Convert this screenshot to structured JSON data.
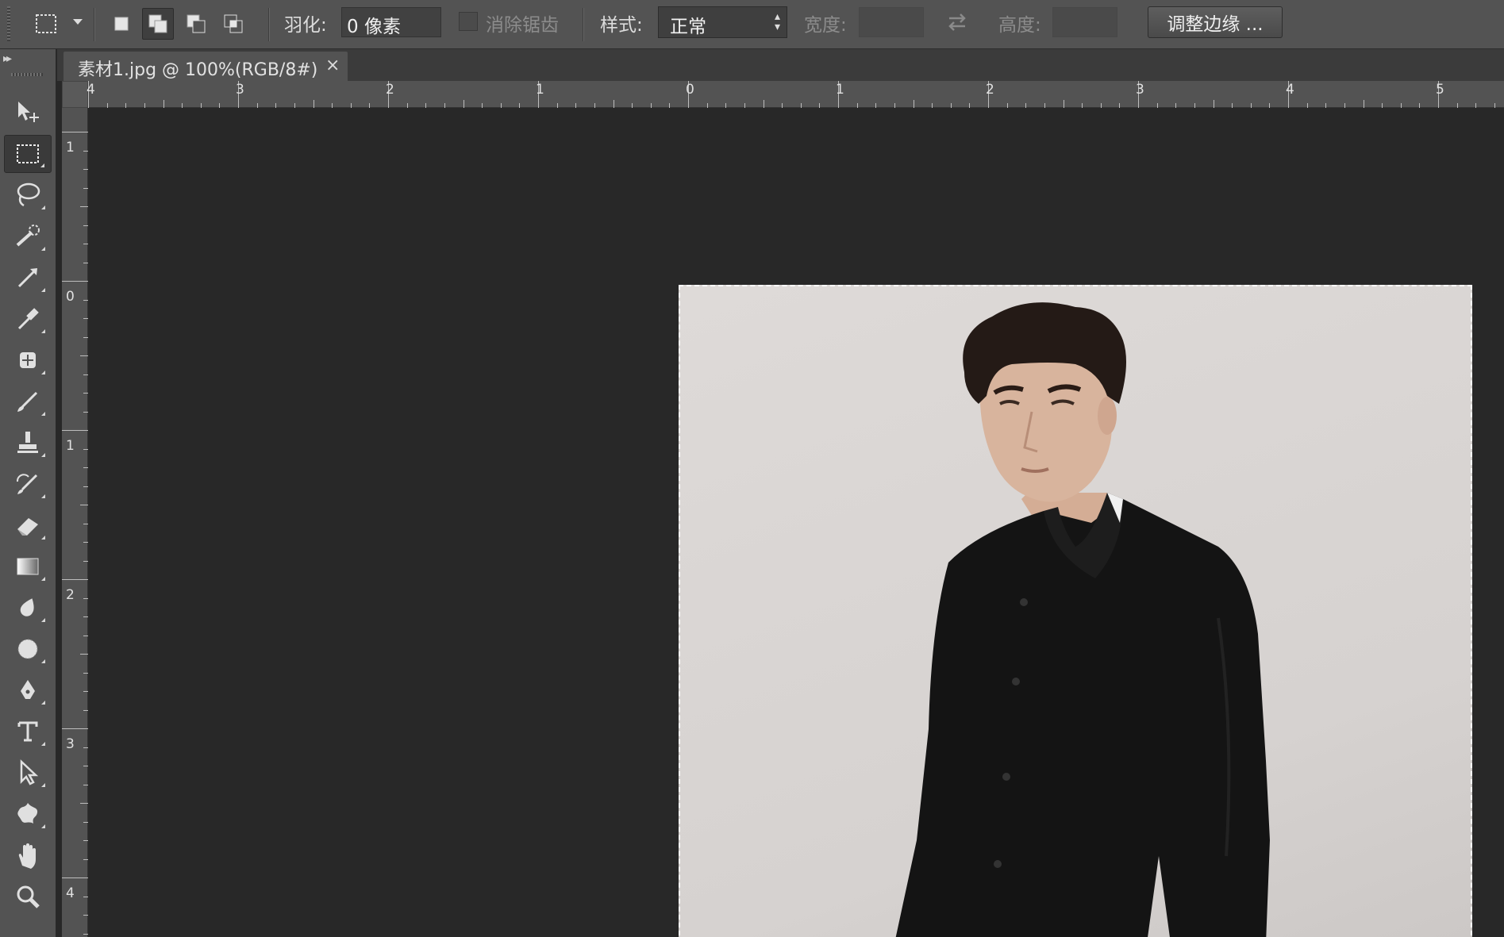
{
  "options_bar": {
    "feather_label": "羽化:",
    "feather_value": "0 像素",
    "antialias_label": "消除锯齿",
    "style_label": "样式:",
    "style_value": "正常",
    "width_label": "宽度:",
    "height_label": "高度:",
    "refine_edge_label": "调整边缘 ..."
  },
  "document": {
    "tab_title": "素材1.jpg @ 100%(RGB/8#)",
    "close_glyph": "×"
  },
  "rulers": {
    "horizontal": [
      "4",
      "3",
      "2",
      "1",
      "0",
      "1",
      "2",
      "3",
      "4",
      "5"
    ],
    "vertical": [
      "1",
      "0",
      "1",
      "2",
      "3",
      "4"
    ]
  },
  "toolbox": {
    "tools": [
      "move",
      "rectangular-marquee",
      "lasso",
      "quick-selection",
      "crop",
      "eyedropper",
      "spot-healing",
      "brush",
      "clone-stamp",
      "history-brush",
      "eraser",
      "gradient",
      "blur",
      "dodge",
      "pen",
      "type",
      "path-selection",
      "custom-shape",
      "hand",
      "zoom"
    ],
    "active_tool": "rectangular-marquee"
  },
  "colors": {
    "panel": "#535353",
    "canvas_bg": "#282828",
    "photo_bg": "#dcd8d6",
    "jacket": "#141414",
    "hair": "#241a16",
    "skin": "#d8b49d"
  }
}
